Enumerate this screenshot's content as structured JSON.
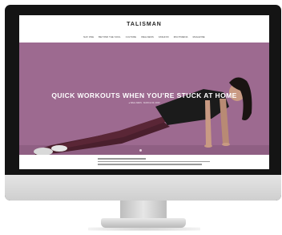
{
  "site": {
    "brand": "TALISMAN",
    "nav": [
      "NAV ONE",
      "BEYOND THE SOUL",
      "CULTURE",
      "WELLNESS",
      "FASHION",
      "MULTIMEDIA",
      "MAGAZINE"
    ]
  },
  "hero": {
    "title": "QUICK WORKOUTS WHEN YOU'RE STUCK AT HOME",
    "meta": "● WELLNESS · MARCH 30, 2020",
    "slide_count": 1,
    "active_slide": 1
  },
  "colors": {
    "hero_bg": "#9d6a90",
    "monitor_frame": "#141414"
  }
}
